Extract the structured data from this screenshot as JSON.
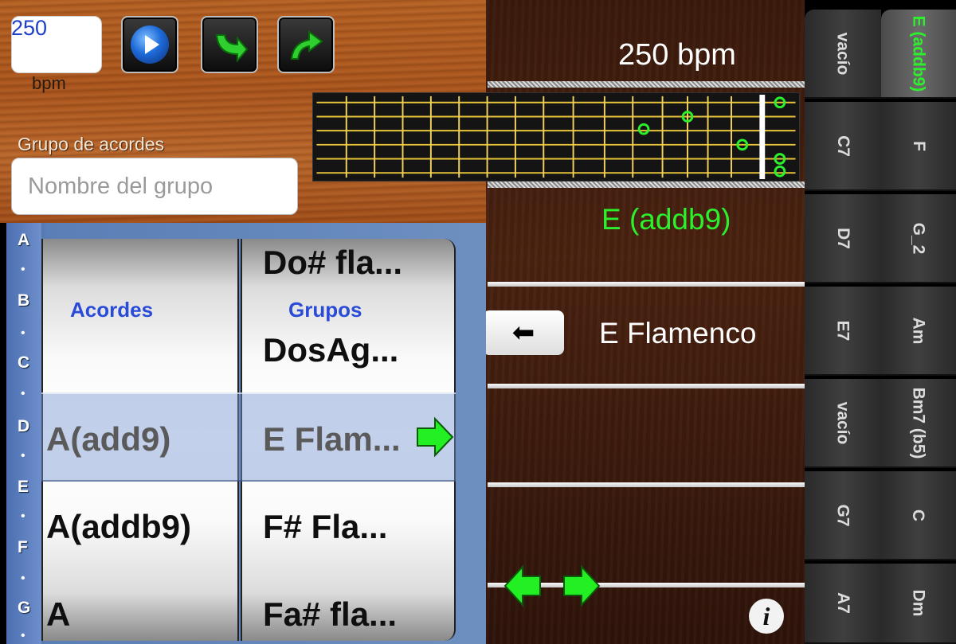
{
  "controls": {
    "bpm_value": "250",
    "bpm_label": "bpm",
    "play_button": "play-icon",
    "forward_button": "redo-arrow-icon",
    "back_button": "undo-arrow-icon",
    "group_label": "Grupo de acordes",
    "group_placeholder": "Nombre del grupo"
  },
  "display": {
    "bpm_text": "250 bpm",
    "chord_name": "E (addb9)",
    "current_group": "E Flamenco"
  },
  "picker": {
    "index_letters": [
      "A",
      "B",
      "C",
      "D",
      "E",
      "F",
      "G"
    ],
    "col1_header": "Acordes",
    "col2_header": "Grupos",
    "col1_items": [
      "A(add9)",
      "A(addb9)",
      "A"
    ],
    "col2_items": [
      "Do# fla...",
      "DosAg...",
      "E Flam...",
      "F# Fla...",
      "Fa# fla..."
    ]
  },
  "chord_tabs": {
    "left_column": [
      "vacío",
      "C7",
      "D7",
      "E7",
      "vacío",
      "G7",
      "A7"
    ],
    "right_column": [
      "E (addb9)",
      "F",
      "G_2",
      "Am",
      "Bm7 (b5)",
      "C",
      "Dm"
    ],
    "active": "E (addb9)"
  },
  "colors": {
    "accent_green": "#2df02d",
    "bpm_blue": "#1f3fc9",
    "header_blue": "#2a4bd8"
  }
}
